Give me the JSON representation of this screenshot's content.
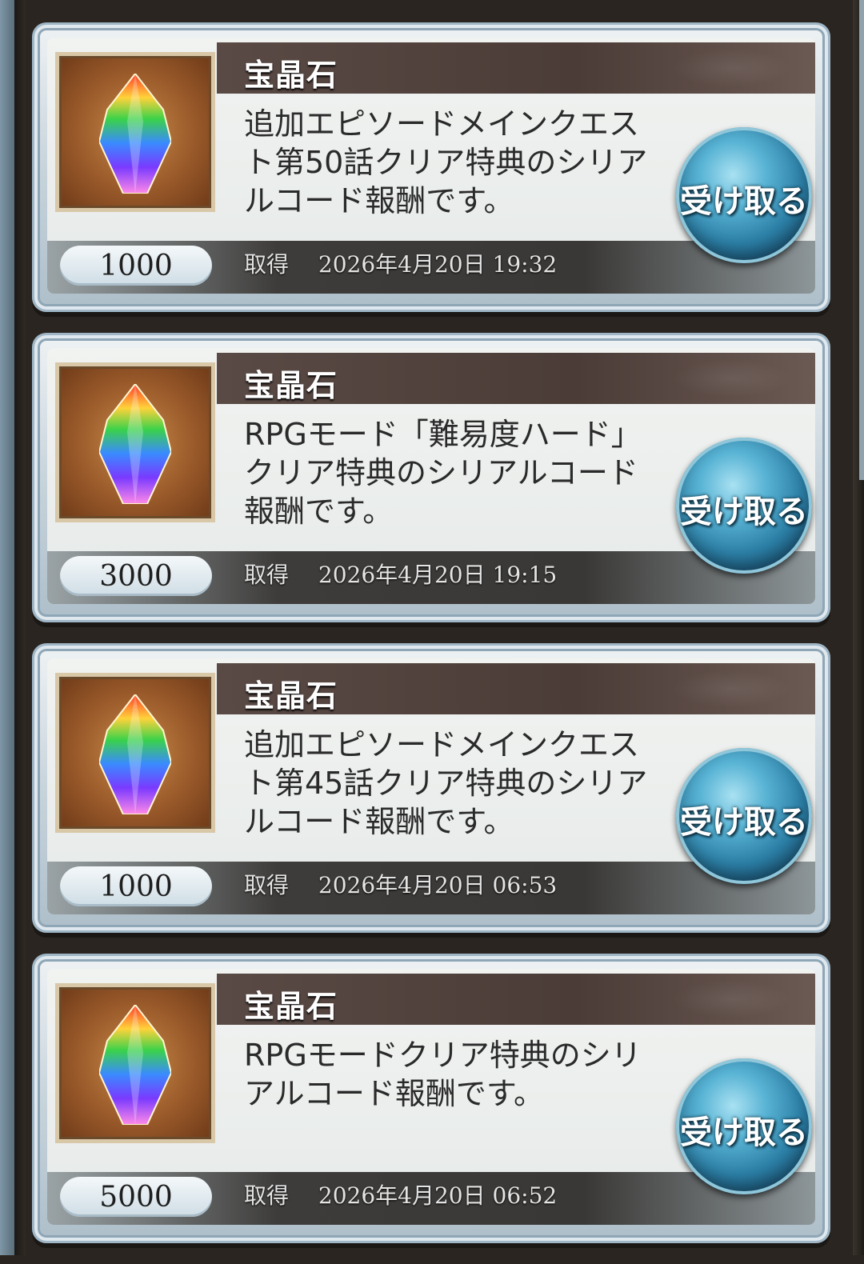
{
  "items": [
    {
      "title": "宝晶石",
      "description": "追加エピソードメインクエスト第50話クリア特典のシリアルコード報酬です。",
      "count": "1000",
      "acquired_label": "取得",
      "acquired_date": "2026年4月20日 19:32",
      "claim_label": "受け取る",
      "icon": "rainbow-crystal-icon"
    },
    {
      "title": "宝晶石",
      "description": "RPGモード「難易度ハード」クリア特典のシリアルコード報酬です。",
      "count": "3000",
      "acquired_label": "取得",
      "acquired_date": "2026年4月20日 19:15",
      "claim_label": "受け取る",
      "icon": "rainbow-crystal-icon"
    },
    {
      "title": "宝晶石",
      "description": "追加エピソードメインクエスト第45話クリア特典のシリアルコード報酬です。",
      "count": "1000",
      "acquired_label": "取得",
      "acquired_date": "2026年4月20日 06:53",
      "claim_label": "受け取る",
      "icon": "rainbow-crystal-icon"
    },
    {
      "title": "宝晶石",
      "description": "RPGモードクリア特典のシリアルコード報酬です。",
      "count": "5000",
      "acquired_label": "取得",
      "acquired_date": "2026年4月20日 06:52",
      "claim_label": "受け取る",
      "icon": "rainbow-crystal-icon"
    }
  ],
  "colors": {
    "claim_button": "#2c7fa6",
    "title_bar": "#4b3c37",
    "card_border": "#9fb6c6"
  }
}
